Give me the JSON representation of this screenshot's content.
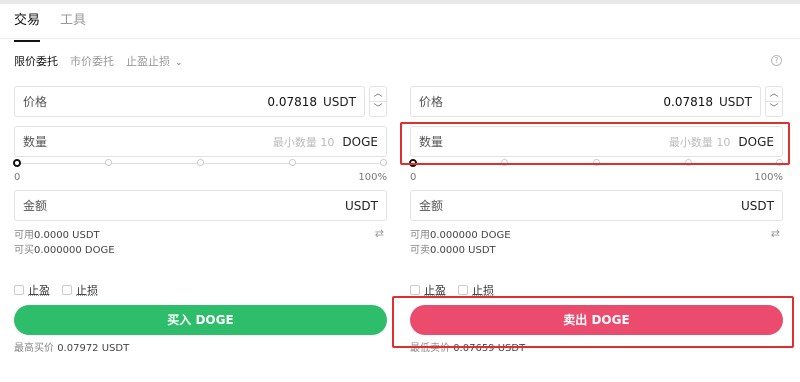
{
  "tabs": [
    {
      "label": "交易",
      "active": true
    },
    {
      "label": "工具",
      "active": false
    }
  ],
  "order_types": [
    {
      "label": "限价委托",
      "active": true
    },
    {
      "label": "市价委托",
      "active": false
    },
    {
      "label": "止盈止损",
      "active": false,
      "has_dropdown": true
    }
  ],
  "icons": {
    "help": "help-icon",
    "swap": "swap-icon",
    "up": "chevron-up-icon",
    "down": "chevron-down-icon"
  },
  "buy": {
    "price_label": "价格",
    "price_value": "0.07818",
    "price_unit": "USDT",
    "qty_label": "数量",
    "qty_placeholder": "最小数量 10",
    "qty_unit": "DOGE",
    "slider_min": "0",
    "slider_max": "100%",
    "slider_value": 0,
    "amount_label": "金额",
    "amount_unit": "USDT",
    "avail_label": "可用",
    "avail_value": "0.0000 USDT",
    "can_label": "可买",
    "can_value": "0.000000 DOGE",
    "take_profit": "止盈",
    "stop_loss": "止损",
    "action": "买入 DOGE",
    "best_label": "最高买价",
    "best_value": "0.07972 USDT",
    "color": "#2ebd6a"
  },
  "sell": {
    "price_label": "价格",
    "price_value": "0.07818",
    "price_unit": "USDT",
    "qty_label": "数量",
    "qty_placeholder": "最小数量 10",
    "qty_unit": "DOGE",
    "slider_min": "0",
    "slider_max": "100%",
    "slider_value": 0,
    "amount_label": "金额",
    "amount_unit": "USDT",
    "avail_label": "可用",
    "avail_value": "0.000000 DOGE",
    "can_label": "可卖",
    "can_value": "0.0000 USDT",
    "take_profit": "止盈",
    "stop_loss": "止损",
    "action": "卖出 DOGE",
    "best_label": "最低卖价",
    "best_value": "0.07659 USDT",
    "color": "#eb4c6e"
  },
  "annotation_color": "#e02f2f"
}
